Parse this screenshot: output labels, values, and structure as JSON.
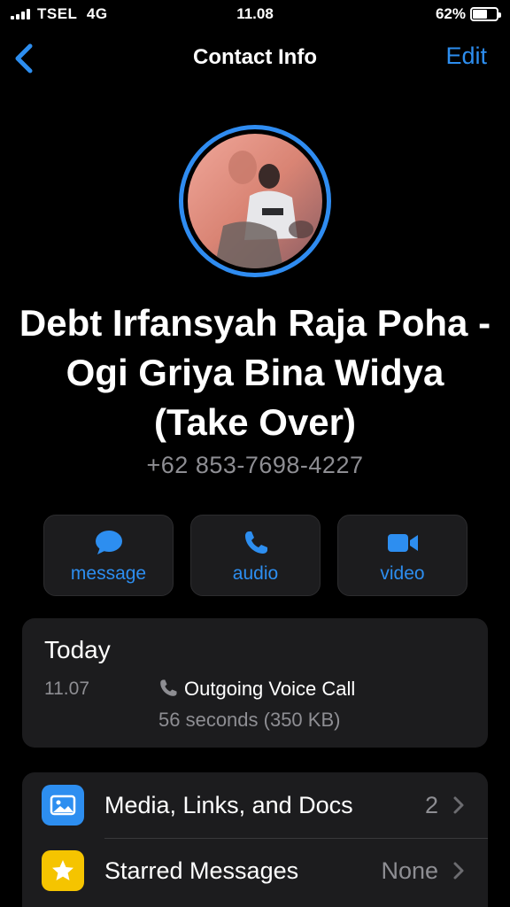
{
  "status_bar": {
    "carrier": "TSEL",
    "network": "4G",
    "time": "11.08",
    "battery_percent": "62%",
    "battery_level": 0.62
  },
  "nav": {
    "back_icon": "chevron-left-icon",
    "title": "Contact Info",
    "edit_label": "Edit"
  },
  "contact": {
    "avatar_icon": "contact-photo",
    "name": "Debt Irfansyah Raja Poha - Ogi Griya Bina Widya (Take Over)",
    "phone": "+62 853-7698-4227"
  },
  "actions": [
    {
      "icon": "message-bubble-icon",
      "label": "message"
    },
    {
      "icon": "phone-icon",
      "label": "audio"
    },
    {
      "icon": "video-camera-icon",
      "label": "video"
    }
  ],
  "call_log": {
    "day": "Today",
    "time": "11.07",
    "type_icon": "phone-icon",
    "type": "Outgoing Voice Call",
    "detail": "56 seconds (350 KB)"
  },
  "list": [
    {
      "icon": "photo-icon",
      "icon_color": "#2d8ef0",
      "label": "Media, Links, and Docs",
      "value": "2"
    },
    {
      "icon": "star-icon",
      "icon_color": "#f5c400",
      "label": "Starred Messages",
      "value": "None"
    }
  ],
  "colors": {
    "accent": "#2d8ef0",
    "background": "#000000",
    "card": "#1c1c1e",
    "secondary_text": "#8e8e93"
  }
}
